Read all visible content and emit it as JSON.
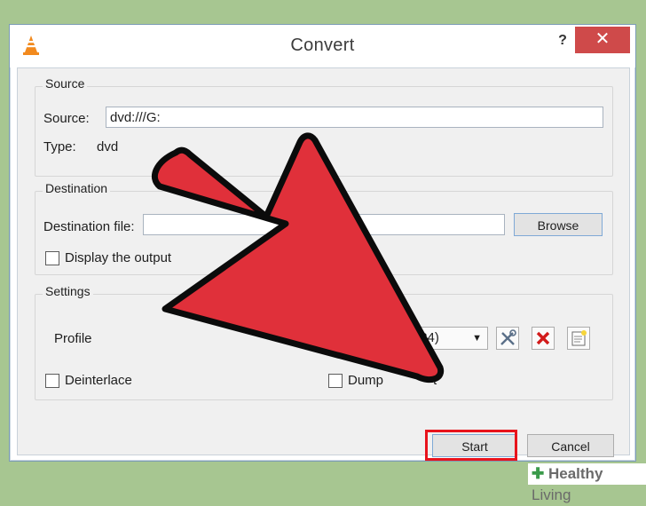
{
  "window": {
    "title": "Convert",
    "help_label": "?",
    "close_label": "✕",
    "icon": "vlc-cone-icon"
  },
  "source": {
    "group_label": "Source",
    "source_label": "Source:",
    "source_value": "dvd:///G:",
    "type_label": "Type:",
    "type_value": "dvd"
  },
  "destination": {
    "group_label": "Destination",
    "file_label": "Destination file:",
    "file_value": "",
    "browse_label": "Browse",
    "display_output_label": "Display the output",
    "display_output_checked": false
  },
  "settings": {
    "group_label": "Settings",
    "profile_label": "Profile",
    "profile_value": "MP4)",
    "edit_profile_icon": "tools-icon",
    "delete_profile_icon": "red-x-icon",
    "new_profile_icon": "new-profile-icon",
    "deinterlace_label": "Deinterlace",
    "deinterlace_checked": false,
    "dump_raw_label_left": "Dump",
    "dump_raw_label_right": "t",
    "dump_raw_checked": false
  },
  "actions": {
    "start_label": "Start",
    "cancel_label": "Cancel"
  },
  "annotation": {
    "arrow_color": "#e0303a",
    "highlight_color": "#e8131c"
  },
  "watermark": {
    "brand": "Healthy",
    "brand_light": "Living"
  }
}
